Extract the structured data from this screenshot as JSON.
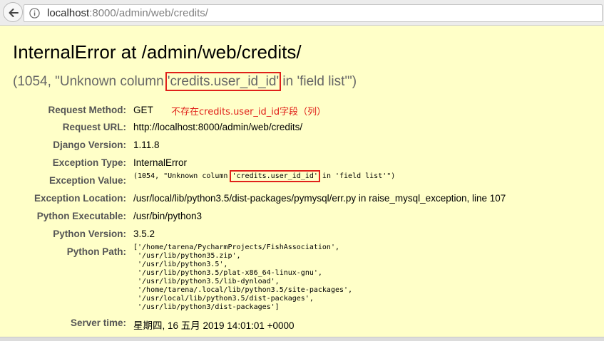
{
  "browser": {
    "url_host": "localhost",
    "url_rest": ":8000/admin/web/credits/",
    "back_icon": "back-arrow-icon",
    "info_icon": "info-icon"
  },
  "error": {
    "title": "InternalError at /admin/web/credits/",
    "message_prefix": "(1054, \"Unknown column ",
    "message_highlight": "'credits.user_id_id'",
    "message_suffix": " in 'field list'\")",
    "annotation": "不存在credits.user_id_id字段（列）",
    "highlight_color": "#e0211a"
  },
  "details": {
    "request_method": {
      "label": "Request Method:",
      "value": "GET"
    },
    "request_url": {
      "label": "Request URL:",
      "value": "http://localhost:8000/admin/web/credits/"
    },
    "django_version": {
      "label": "Django Version:",
      "value": "1.11.8"
    },
    "exception_type": {
      "label": "Exception Type:",
      "value": "InternalError"
    },
    "exception_value": {
      "label": "Exception Value:",
      "prefix": "(1054, \"Unknown column ",
      "highlight": "'credits.user_id_id'",
      "suffix": " in 'field list'\")"
    },
    "exception_location": {
      "label": "Exception Location:",
      "value": "/usr/local/lib/python3.5/dist-packages/pymysql/err.py in raise_mysql_exception, line 107"
    },
    "python_executable": {
      "label": "Python Executable:",
      "value": "/usr/bin/python3"
    },
    "python_version": {
      "label": "Python Version:",
      "value": "3.5.2"
    },
    "python_path": {
      "label": "Python Path:",
      "value": "['/home/tarena/PycharmProjects/FishAssociation',\n '/usr/lib/python35.zip',\n '/usr/lib/python3.5',\n '/usr/lib/python3.5/plat-x86_64-linux-gnu',\n '/usr/lib/python3.5/lib-dynload',\n '/home/tarena/.local/lib/python3.5/site-packages',\n '/usr/local/lib/python3.5/dist-packages',\n '/usr/lib/python3/dist-packages']"
    },
    "server_time": {
      "label": "Server time:",
      "value": "星期四, 16 五月 2019 14:01:01 +0000"
    }
  }
}
